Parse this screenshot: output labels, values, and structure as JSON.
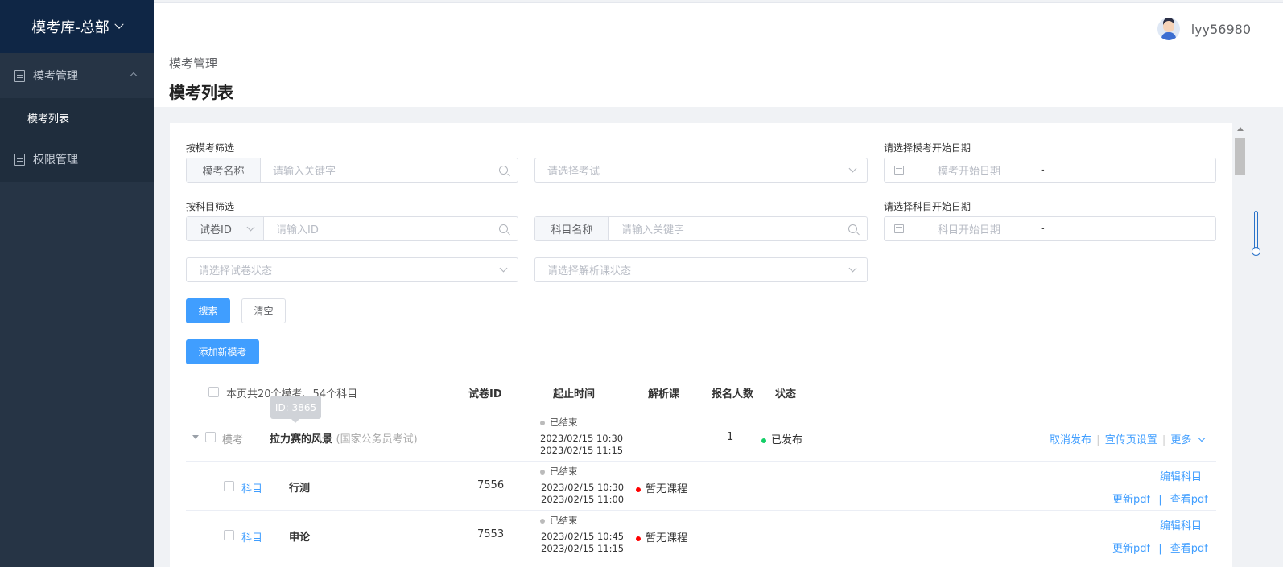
{
  "sidebar": {
    "brand": "模考库-总部",
    "group1": "模考管理",
    "sub1": "模考列表",
    "group2": "权限管理"
  },
  "header": {
    "username": "lyy56980",
    "breadcrumb": "模考管理",
    "title": "模考列表"
  },
  "filters": {
    "label_mock": "按模考筛选",
    "mock_name_prepend": "模考名称",
    "mock_name_placeholder": "请输入关键字",
    "exam_select_placeholder": "请选择考试",
    "label_mock_date": "请选择模考开始日期",
    "mock_date_placeholder": "模考开始日期",
    "date_sep": "-",
    "label_subject": "按科目筛选",
    "paper_id_prepend": "试卷ID",
    "paper_id_placeholder": "请输入ID",
    "subject_name_prepend": "科目名称",
    "subject_name_placeholder": "请输入关键字",
    "label_subject_date": "请选择科目开始日期",
    "subject_date_placeholder": "科目开始日期",
    "paper_status_placeholder": "请选择试卷状态",
    "lesson_status_placeholder": "请选择解析课状态"
  },
  "buttons": {
    "search": "搜索",
    "clear": "清空",
    "add": "添加新模考"
  },
  "table": {
    "summary": "本页共20个模考、54个科目",
    "headers": {
      "paper_id": "试卷ID",
      "time": "起止时间",
      "lesson": "解析课",
      "count": "报名人数",
      "status": "状态"
    },
    "tooltip": "ID: 3865",
    "mock": {
      "type": "模考",
      "name": "拉力赛的风景",
      "exam": "(国家公务员考试)",
      "time_status": "已结束",
      "start": "2023/02/15 10:30",
      "end": "2023/02/15 11:15",
      "count": "1",
      "status": "已发布",
      "actions": [
        "取消发布",
        "宣传页设置",
        "更多"
      ]
    },
    "subjects": [
      {
        "type": "科目",
        "name": "行测",
        "paper_id": "7556",
        "time_status": "已结束",
        "start": "2023/02/15 10:30",
        "end": "2023/02/15 11:00",
        "lesson": "暂无课程",
        "edit": "编辑科目",
        "update_pdf": "更新pdf",
        "sep": "|",
        "view_pdf": "查看pdf"
      },
      {
        "type": "科目",
        "name": "申论",
        "paper_id": "7553",
        "time_status": "已结束",
        "start": "2023/02/15 10:45",
        "end": "2023/02/15 11:15",
        "lesson": "暂无课程",
        "edit": "编辑科目",
        "update_pdf": "更新pdf",
        "sep": "|",
        "view_pdf": "查看pdf"
      }
    ]
  },
  "colors": {
    "sidebar_bg": "#263445",
    "brand_bg": "#0f2645",
    "primary": "#409eff",
    "status_published": "#13ce66",
    "no_lesson": "#f00"
  }
}
